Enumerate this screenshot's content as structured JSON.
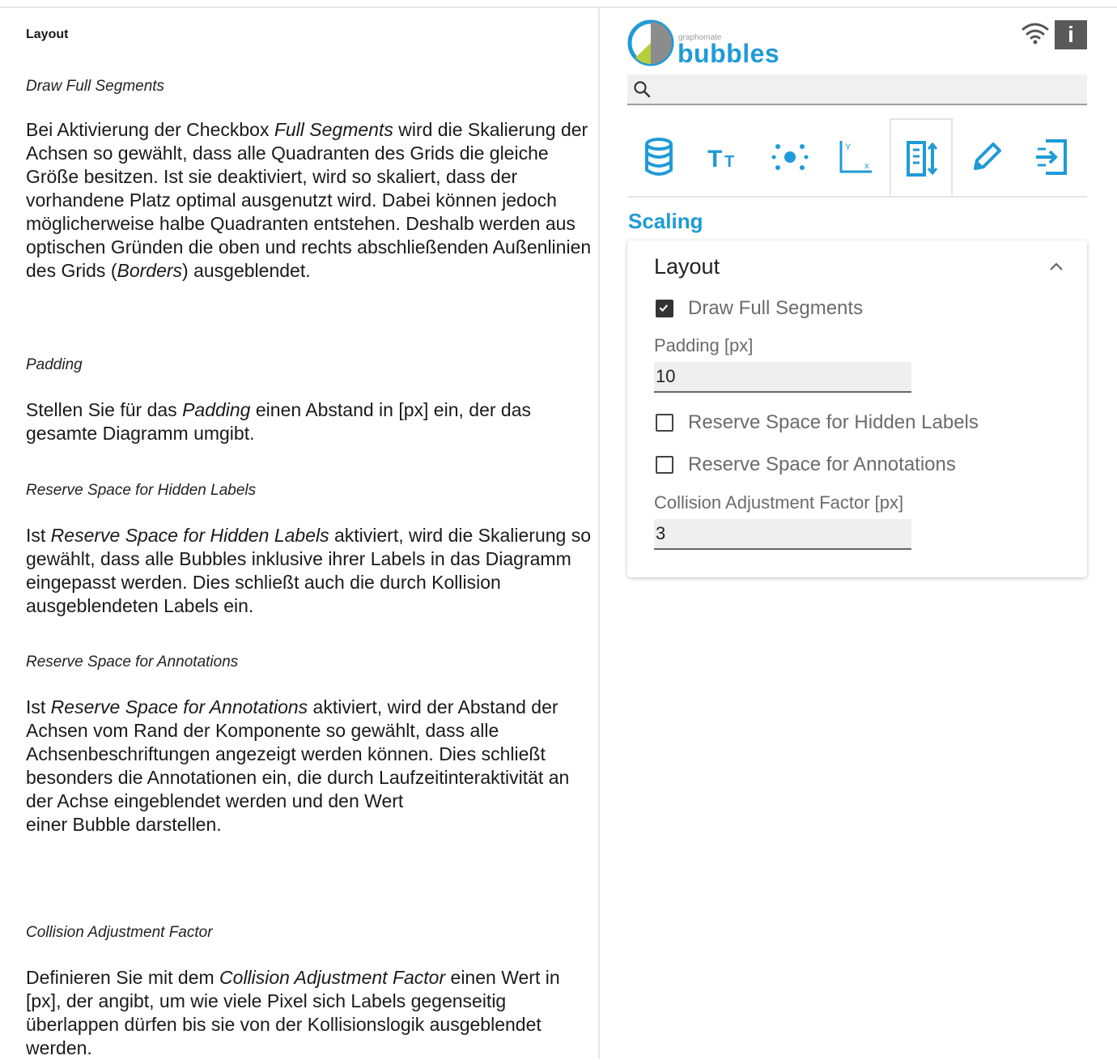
{
  "doc": {
    "heading": "Layout",
    "sections": [
      {
        "title": "Draw Full Segments",
        "body": [
          "Bei Aktivierung der Checkbox ",
          {
            "i": "Full Segments"
          },
          " wird die Skalierung der Achsen so gewählt, dass alle Quadranten des Grids die gleiche Größe besitzen. Ist sie deaktiviert, wird so skaliert, dass der vorhandene Platz optimal ausgenutzt wird. Dabei können jedoch möglicherweise halbe Quadranten entstehen. Deshalb werden aus optischen Gründen die oben und rechts abschließenden Außenlinien des Grids (",
          {
            "i": "Borders"
          },
          ") ausgeblendet."
        ]
      },
      {
        "title": "Padding",
        "body": [
          "Stellen Sie für das ",
          {
            "i": "Padding"
          },
          " einen Abstand in [px] ein, der das gesamte Diagramm umgibt."
        ]
      },
      {
        "title": "Reserve Space for Hidden Labels",
        "body": [
          "Ist ",
          {
            "i": "Reserve Space for Hidden Labels"
          },
          " aktiviert, wird die Skalierung so gewählt, dass alle Bubbles inklusive ihrer Labels in das Diagramm eingepasst werden. Dies schließt auch die durch Kollision ausgeblendeten Labels ein."
        ]
      },
      {
        "title": "Reserve Space for Annotations",
        "body": [
          "Ist ",
          {
            "i": "Reserve Space for Annotations"
          },
          " aktiviert, wird der Abstand der Achsen vom Rand der Komponente so gewählt, dass alle Achsenbeschriftungen angezeigt werden können. Dies schließt besonders die Annotationen ein, die durch Laufzeitinteraktivität an der Achse eingeblendet werden und den Wert",
          {
            "br": true
          },
          "einer Bubble darstellen."
        ]
      },
      {
        "title": "Collision Adjustment Factor",
        "body": [
          "Definieren Sie mit dem ",
          {
            "i": "Collision Adjustment Factor"
          },
          " einen Wert in [px], der angibt, um wie viele Pixel sich Labels gegenseitig überlappen dürfen bis sie von der Kollisionslogik ausgeblendet werden."
        ]
      }
    ]
  },
  "panel": {
    "logo_small": "graphomate",
    "logo_word": "bubbles",
    "info_glyph": "i",
    "search": {
      "value": "",
      "placeholder": ""
    },
    "tabs": [
      {
        "icon": "database-icon",
        "active": false
      },
      {
        "icon": "text-size-icon",
        "active": false
      },
      {
        "icon": "scatter-dots-icon",
        "active": false
      },
      {
        "icon": "axes-icon",
        "active": false
      },
      {
        "icon": "scaling-icon",
        "active": true
      },
      {
        "icon": "pen-icon",
        "active": false
      },
      {
        "icon": "export-icon",
        "active": false
      }
    ],
    "accent": "#1f9bd7",
    "section_title": "Scaling",
    "card": {
      "title": "Layout",
      "draw_full_segments": {
        "label": "Draw Full Segments",
        "checked": true
      },
      "padding": {
        "label": "Padding [px]",
        "value": "10"
      },
      "reserve_hidden": {
        "label": "Reserve Space for Hidden Labels",
        "checked": false
      },
      "reserve_annotations": {
        "label": "Reserve Space for Annotations",
        "checked": false
      },
      "collision": {
        "label": "Collision Adjustment Factor [px]",
        "value": "3"
      }
    }
  }
}
